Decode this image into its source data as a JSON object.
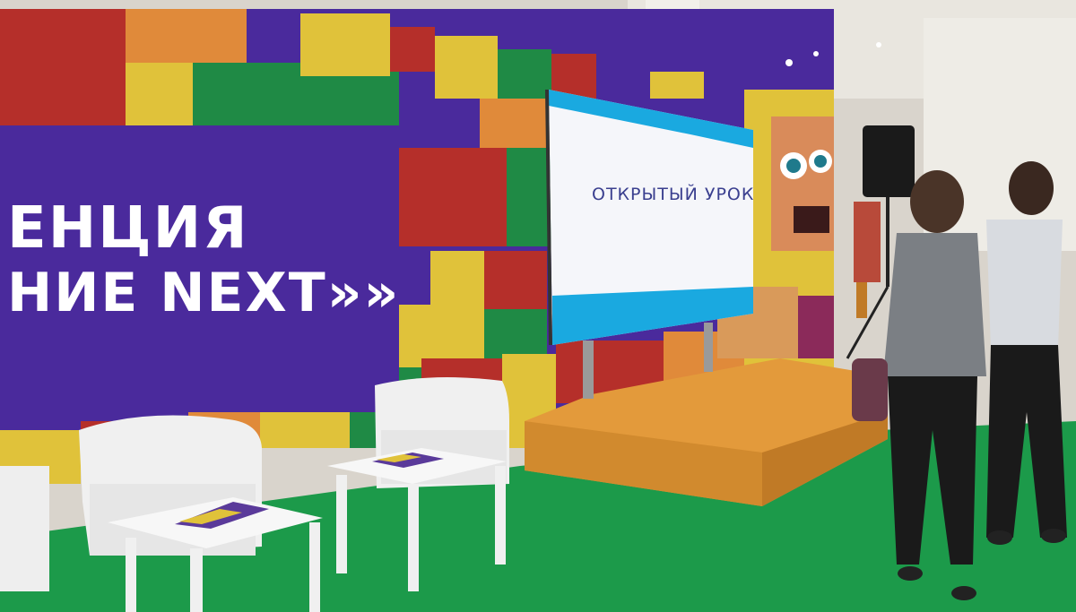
{
  "banner": {
    "line1": "ЕНЦИЯ",
    "line2": "НИЕ NEXT»»"
  },
  "screen": {
    "title": "ОТКРЫТЫЙ УРОК",
    "subtitle": "",
    "tag": ""
  },
  "colors": {
    "banner_purple": "#4a2a9c",
    "carpet_green": "#1c9a4a",
    "stage_orange": "#e39a3b",
    "wall_red": "#b52f2a",
    "wall_yellow": "#e0c23a",
    "wall_green": "#1f8a45",
    "screen_cyan": "#1aa9e0"
  }
}
